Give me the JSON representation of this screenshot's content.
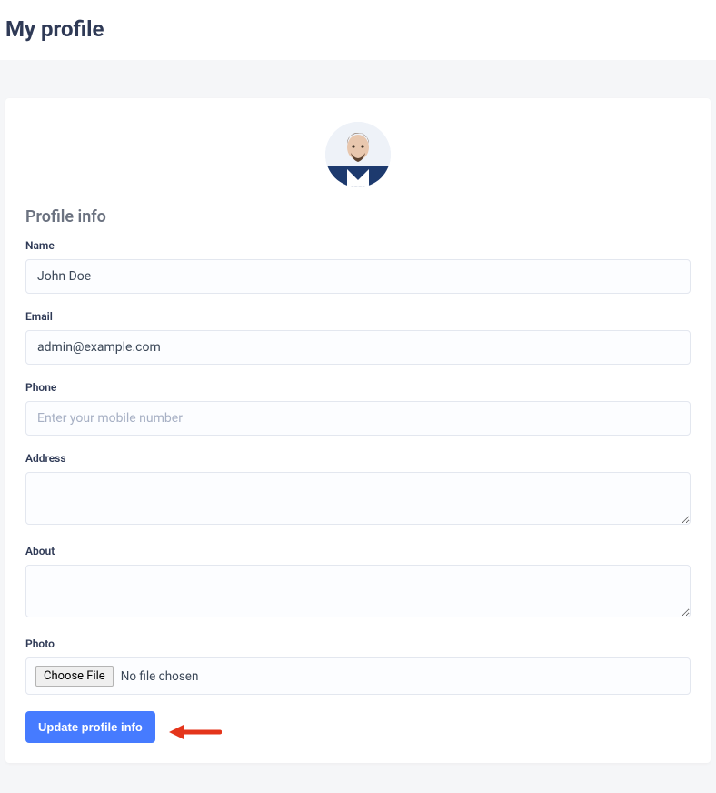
{
  "header": {
    "title": "My profile"
  },
  "profile": {
    "section_title": "Profile info",
    "labels": {
      "name": "Name",
      "email": "Email",
      "phone": "Phone",
      "address": "Address",
      "about": "About",
      "photo": "Photo"
    },
    "values": {
      "name": "John Doe",
      "email": "admin@example.com",
      "phone": "",
      "address": "",
      "about": ""
    },
    "placeholders": {
      "phone": "Enter your mobile number"
    },
    "file": {
      "button": "Choose File",
      "status": "No file chosen"
    },
    "submit": "Update profile info"
  },
  "colors": {
    "primary": "#467bff",
    "heading": "#2f3a56",
    "muted": "#6b7280",
    "border": "#e3e7ef",
    "input_bg": "#fcfdff",
    "annotation": "#e4351b"
  }
}
